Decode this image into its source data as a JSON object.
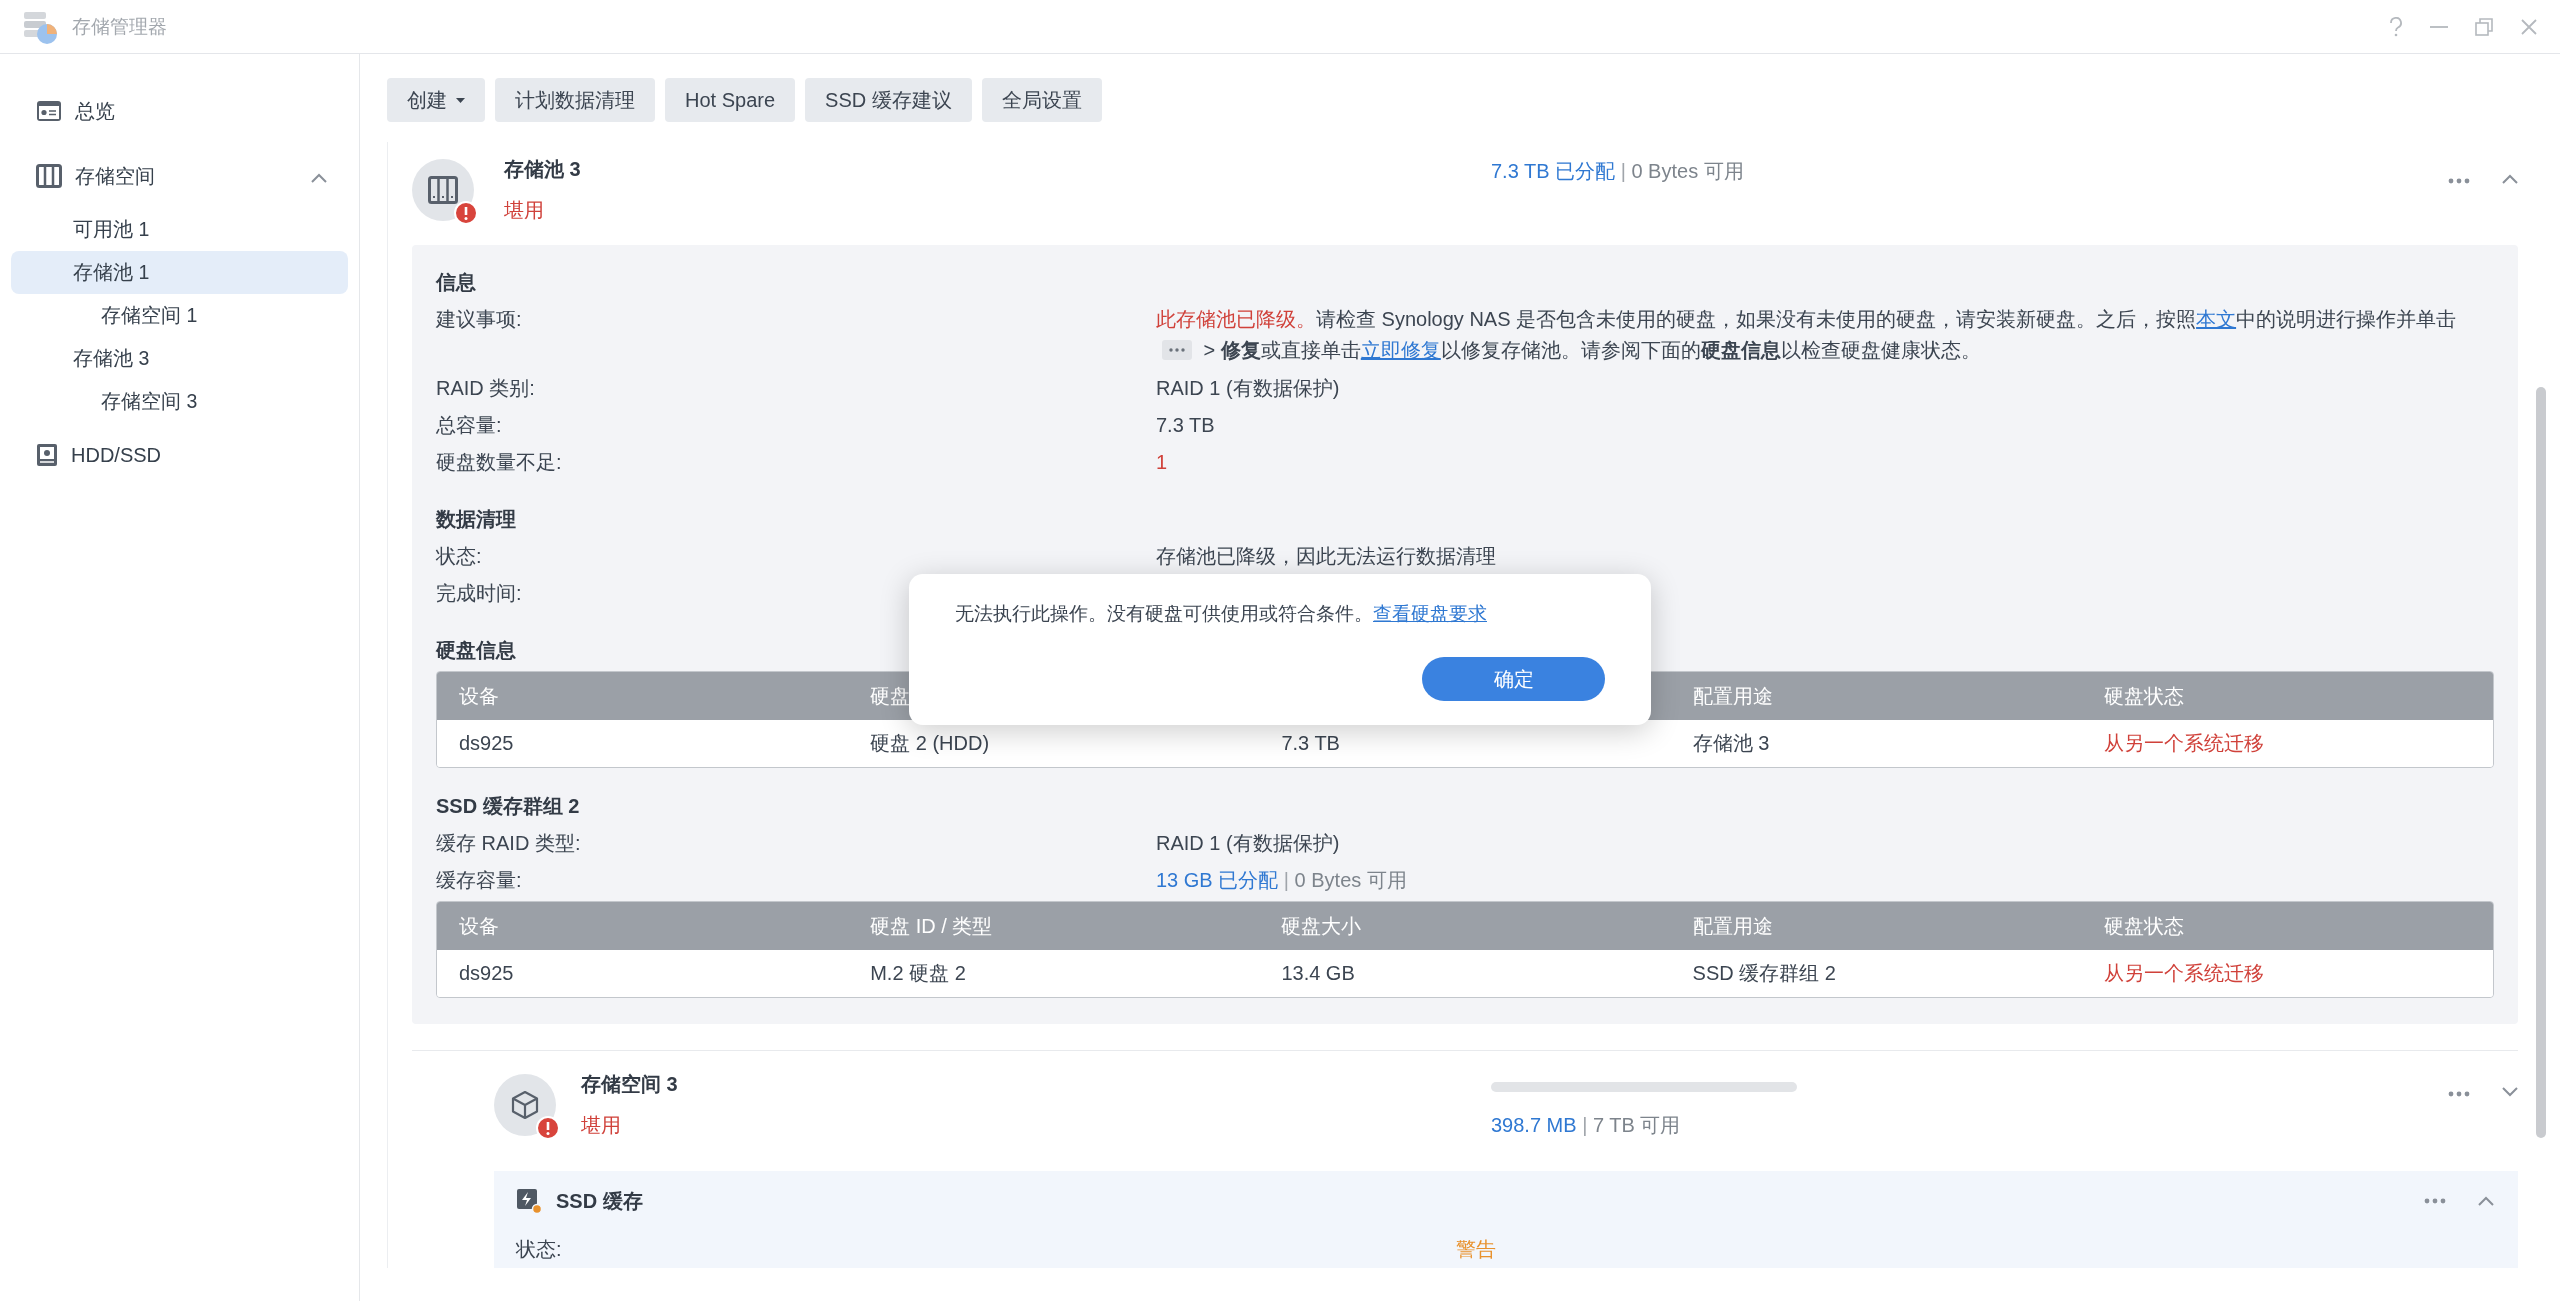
{
  "window": {
    "title": "存储管理器"
  },
  "sidebar": {
    "items": [
      {
        "label": "总览",
        "kind": "overview",
        "selected": false
      },
      {
        "label": "存储空间",
        "kind": "storage",
        "selected": false,
        "expanded": true,
        "children": [
          {
            "label": "可用池 1",
            "selected": false
          },
          {
            "label": "存储池 1",
            "selected": true,
            "children": [
              {
                "label": "存储空间 1",
                "selected": false
              }
            ]
          },
          {
            "label": "存储池 3",
            "selected": false,
            "children": [
              {
                "label": "存储空间 3",
                "selected": false
              }
            ]
          }
        ]
      },
      {
        "label": "HDD/SSD",
        "kind": "drive",
        "selected": false
      }
    ]
  },
  "toolbar": {
    "buttons": [
      {
        "label": "创建",
        "dropdown": true
      },
      {
        "label": "计划数据清理",
        "dropdown": false
      },
      {
        "label": "Hot Spare",
        "dropdown": false
      },
      {
        "label": "SSD 缓存建议",
        "dropdown": false
      },
      {
        "label": "全局设置",
        "dropdown": false
      }
    ]
  },
  "pool": {
    "name": "存储池 3",
    "status": "堪用",
    "warning": true,
    "expanded": true,
    "capacity": {
      "used": "7.3 TB 已分配",
      "separator": "|",
      "free": "0 Bytes 可用"
    },
    "details": [
      {
        "kind": "heading",
        "text": "信息"
      },
      {
        "kind": "advice",
        "label": "建议事项:",
        "segments": [
          {
            "kind": "alert",
            "text": "此存储池已降级。"
          },
          {
            "kind": "text",
            "text": "请检查 Synology NAS 是否包含未使用的硬盘，如果没有未使用的硬盘，请安装新硬盘。之后，按照"
          },
          {
            "kind": "link",
            "text": "本文"
          },
          {
            "kind": "text",
            "text": "中的说明进行操作并单击"
          },
          {
            "kind": "more"
          },
          {
            "kind": "text",
            "text": " > **修复**或直接单击"
          },
          {
            "kind": "link",
            "text": "立即修复"
          },
          {
            "kind": "text",
            "text": "以修复存储池。请参阅下面的**硬盘信息**以检查硬盘健康状态。"
          }
        ]
      },
      {
        "kind": "field",
        "label": "RAID 类别:",
        "value": "RAID 1 (有数据保护)",
        "alert": false
      },
      {
        "kind": "field",
        "label": "总容量:",
        "value": "7.3 TB",
        "alert": false
      },
      {
        "kind": "field",
        "label": "硬盘数量不足:",
        "value": "1",
        "alert": true
      },
      {
        "kind": "heading",
        "text": "数据清理"
      },
      {
        "kind": "field",
        "label": "状态:",
        "value": "存储池已降级，因此无法运行数据清理",
        "alert": false
      },
      {
        "kind": "field",
        "label": "完成时间:"
      },
      {
        "kind": "heading",
        "text": "硬盘信息"
      },
      {
        "kind": "table",
        "columns": [
          "设备",
          "硬盘",
          null,
          "配置用途",
          "硬盘状态"
        ],
        "rows": [
          [
            "ds925",
            "硬盘 2 (HDD)",
            "7.3 TB",
            "存储池 3",
            "从另一个系统迁移"
          ]
        ]
      },
      {
        "kind": "heading",
        "text": "SSD 缓存群组 2"
      },
      {
        "kind": "field",
        "label": "缓存 RAID 类型:",
        "value": "RAID 1 (有数据保护)",
        "alert": false
      },
      {
        "kind": "capacity",
        "label": "缓存容量:",
        "capacity": {
          "used": "13 GB 已分配",
          "separator": "|",
          "free": "0 Bytes 可用"
        }
      },
      {
        "kind": "table",
        "columns": [
          "设备",
          "硬盘 ID / 类型",
          "硬盘大小",
          "配置用途",
          "硬盘状态"
        ],
        "rows": [
          [
            "ds925",
            "M.2 硬盘 2",
            "13.4 GB",
            "SSD 缓存群组 2",
            "从另一个系统迁移"
          ]
        ]
      }
    ]
  },
  "volume": {
    "name": "存储空间 3",
    "status": "堪用",
    "warning": true,
    "expanded": false,
    "capacity": {
      "used": "398.7 MB",
      "separator": "|",
      "free": "7 TB 可用"
    }
  },
  "ssd_cache": {
    "title": "SSD 缓存",
    "expanded": true,
    "rows": [
      {
        "label": "状态:",
        "value": "警告"
      }
    ]
  },
  "dialog": {
    "message": "无法执行此操作。没有硬盘可供使用或符合条件。",
    "link": "查看硬盘要求",
    "button": "确定"
  }
}
